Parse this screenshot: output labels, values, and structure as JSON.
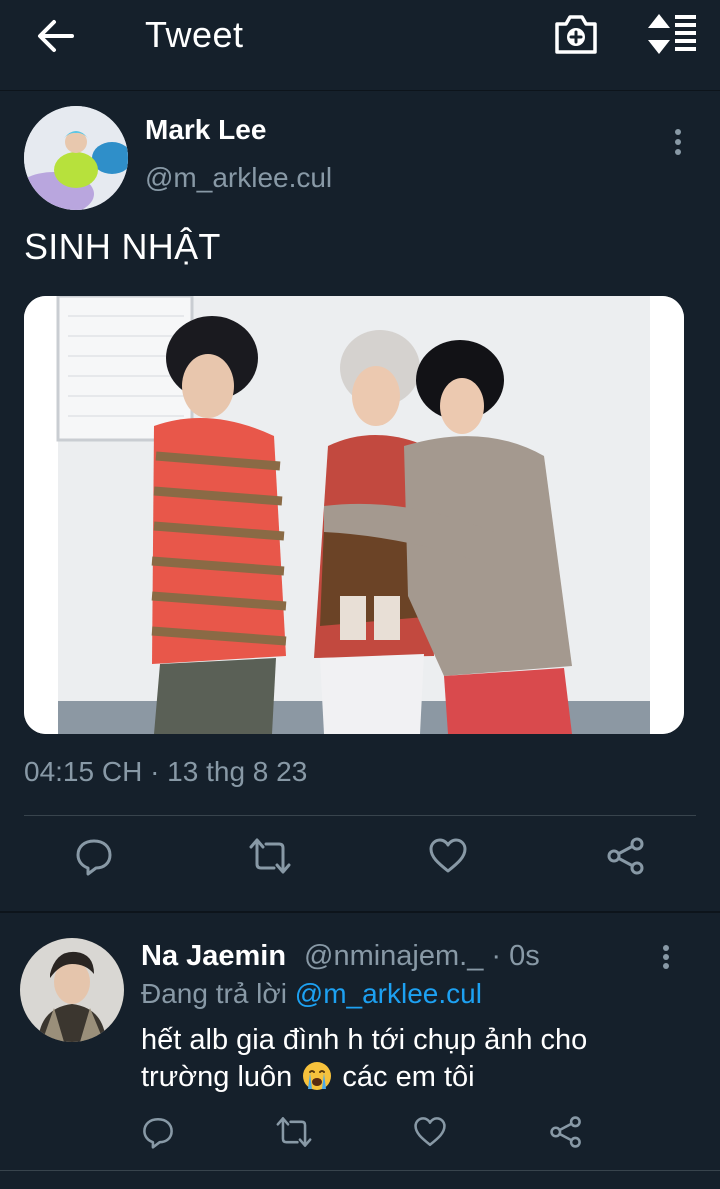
{
  "header": {
    "title": "Tweet",
    "back_icon": "back-arrow-icon",
    "camera_icon": "camera-plus-icon",
    "sort_icon": "sort-icon"
  },
  "tweet": {
    "author_name": "Mark Lee",
    "author_handle": "@m_arklee.cul",
    "text": "SINH NHẬT",
    "timestamp": "04:15 CH · 13 thg 8 23",
    "photo_icon": "tweet-photo"
  },
  "actions": [
    "reply-icon",
    "retweet-icon",
    "like-icon",
    "share-icon"
  ],
  "reply": {
    "author_name": "Na Jaemin",
    "author_handle": "@nminajem._",
    "time": "· 0s",
    "replying_prefix": "Đang trả lời",
    "replying_to": "@m_arklee.cul",
    "text_line1": "hết alb gia đình h tới chụp ảnh cho",
    "text_line2_a": "trường luôn",
    "text_line2_b": "các em tôi"
  },
  "colors": {
    "background": "#15202b",
    "secondary_text": "#8899a6",
    "link": "#1da1f2",
    "divider": "#38444d"
  }
}
